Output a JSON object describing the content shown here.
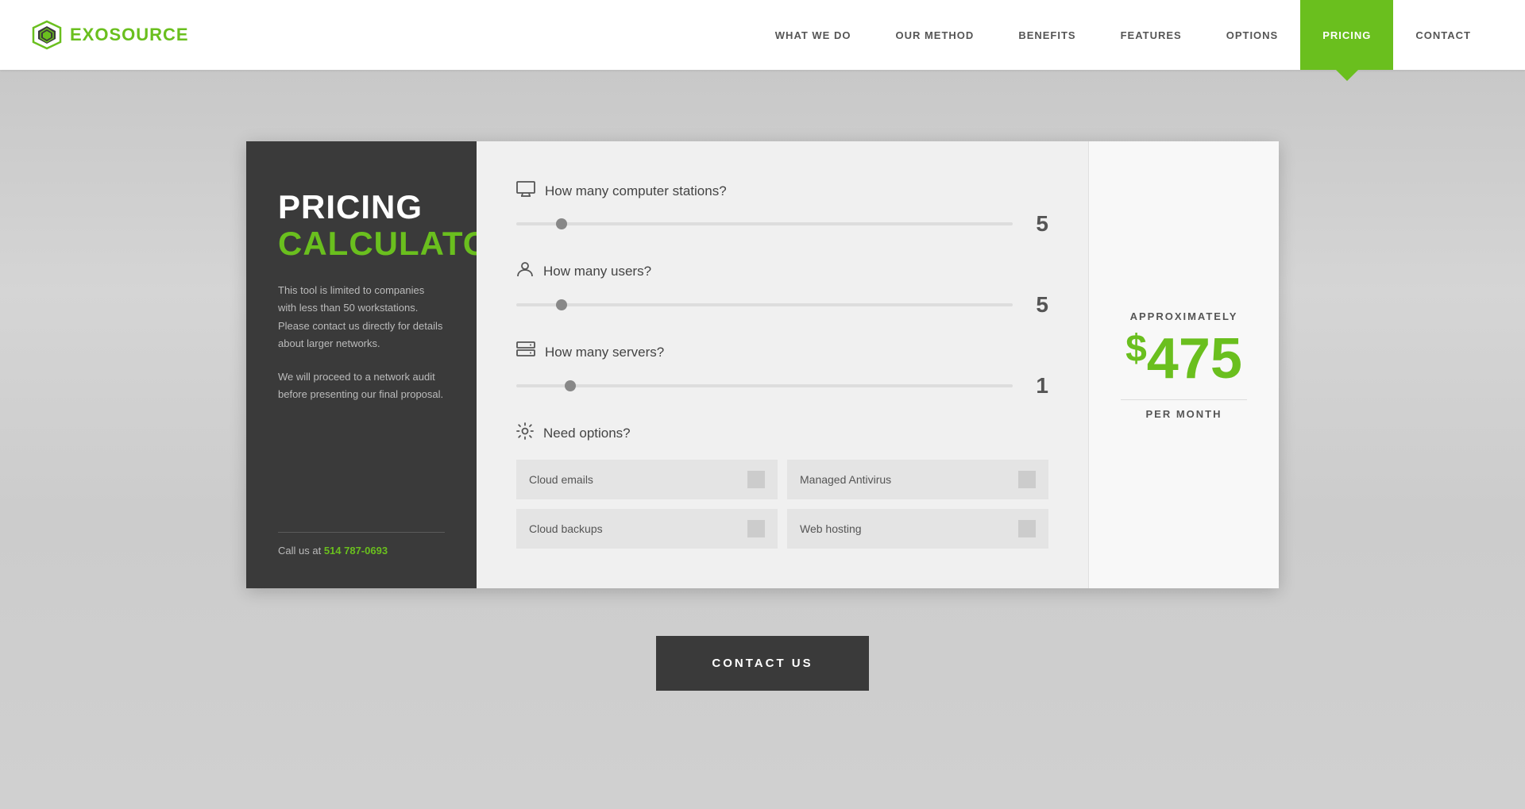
{
  "logo": {
    "text_ex": "EXO",
    "text_source": "SOURCE"
  },
  "nav": {
    "items": [
      {
        "id": "what-we-do",
        "label": "WHAT WE DO",
        "active": false
      },
      {
        "id": "our-method",
        "label": "OUR METHOD",
        "active": false
      },
      {
        "id": "benefits",
        "label": "BENEFITS",
        "active": false
      },
      {
        "id": "features",
        "label": "FEATURES",
        "active": false
      },
      {
        "id": "options",
        "label": "OPTIONS",
        "active": false
      },
      {
        "id": "pricing",
        "label": "PRICING",
        "active": true
      },
      {
        "id": "contact",
        "label": "CONTACT",
        "active": false
      }
    ]
  },
  "calculator": {
    "left": {
      "title_line1": "PRICING",
      "title_line2": "CALCULATOR",
      "desc1": "This tool is limited to companies with less than 50 workstations. Please contact us directly for details about larger networks.",
      "desc2": "We will proceed to a network audit before presenting our final proposal.",
      "call_text": "Call us at ",
      "phone": "514 787-0693"
    },
    "sliders": [
      {
        "id": "computer-stations",
        "label": "How many computer stations?",
        "icon": "🖥",
        "value": 5,
        "min": 1,
        "max": 50
      },
      {
        "id": "users",
        "label": "How many users?",
        "icon": "👤",
        "value": 5,
        "min": 1,
        "max": 50
      },
      {
        "id": "servers",
        "label": "How many servers?",
        "icon": "🗄",
        "value": 1,
        "min": 0,
        "max": 10
      }
    ],
    "options_label": "Need options?",
    "options": [
      {
        "id": "cloud-emails",
        "label": "Cloud emails",
        "checked": false
      },
      {
        "id": "managed-antivirus",
        "label": "Managed Antivirus",
        "checked": false
      },
      {
        "id": "cloud-backups",
        "label": "Cloud backups",
        "checked": false
      },
      {
        "id": "web-hosting",
        "label": "Web hosting",
        "checked": false
      }
    ],
    "result": {
      "approximately": "APPROXIMATELY",
      "price_symbol": "$",
      "price_value": "475",
      "per_month": "PER MONTH"
    }
  },
  "footer": {
    "contact_btn": "CONTACT US"
  }
}
